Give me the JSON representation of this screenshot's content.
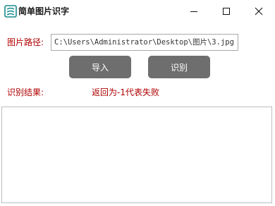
{
  "window": {
    "title": "简单图片识字",
    "icon": "app-scan-icon",
    "controls": [
      "minimize-icon",
      "maximize-icon",
      "close-icon"
    ]
  },
  "form": {
    "path_label": "图片路径:",
    "path_value": "C:\\Users\\Administrator\\Desktop\\图片\\3.jpg",
    "import_button": "导入",
    "recognize_button": "识别",
    "result_label": "识别结果:",
    "result_message": "返回为-1代表失败",
    "result_text": ""
  },
  "colors": {
    "label_red": "#b00000",
    "button_gray": "#6e6e6e",
    "icon_teal": "#1a8a8a"
  }
}
